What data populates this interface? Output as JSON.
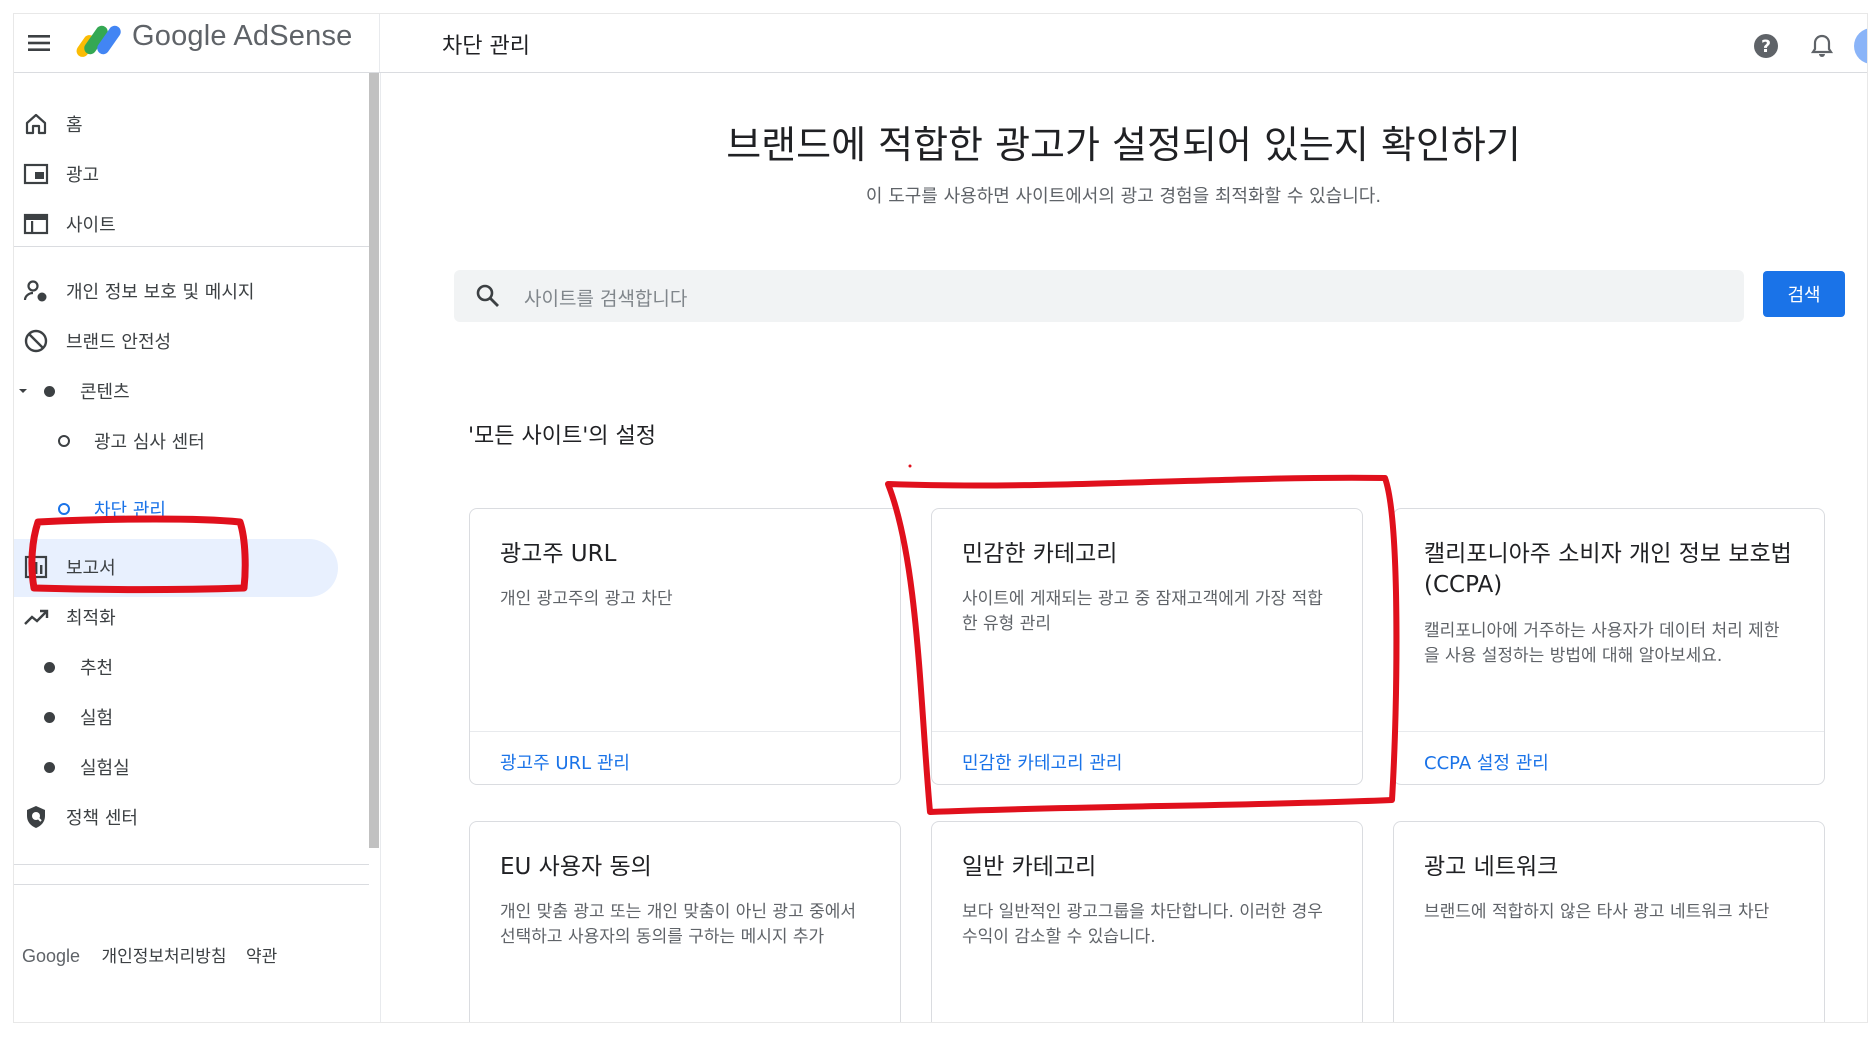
{
  "header": {
    "logo_text": "Google AdSense",
    "page_title": "차단 관리"
  },
  "sidebar": {
    "items": [
      {
        "label": "홈",
        "icon": "home-icon"
      },
      {
        "label": "광고",
        "icon": "ads-icon"
      },
      {
        "label": "사이트",
        "icon": "sites-icon"
      },
      {
        "label": "개인 정보 보호 및 메시지",
        "icon": "privacy-messaging-icon"
      },
      {
        "label": "브랜드 안전성",
        "icon": "block-icon"
      },
      {
        "label": "콘텐츠",
        "icon": "dot-icon"
      },
      {
        "label": "광고 심사 센터",
        "icon": "ring-icon"
      },
      {
        "label": "차단 관리",
        "icon": "ring-icon",
        "active": true
      },
      {
        "label": "보고서",
        "icon": "reports-icon"
      },
      {
        "label": "최적화",
        "icon": "trending-up-icon"
      },
      {
        "label": "추천",
        "icon": "dot-icon"
      },
      {
        "label": "실험",
        "icon": "dot-icon"
      },
      {
        "label": "실험실",
        "icon": "dot-icon"
      },
      {
        "label": "정책 센터",
        "icon": "policy-shield-icon"
      }
    ],
    "footer": {
      "brand": "Google",
      "privacy": "개인정보처리방침",
      "terms": "약관"
    }
  },
  "main": {
    "title": "브랜드에 적합한 광고가 설정되어 있는지 확인하기",
    "subtitle": "이 도구를 사용하면 사이트에서의 광고 경험을 최적화할 수 있습니다.",
    "search": {
      "placeholder": "사이트를 검색합니다",
      "button": "검색"
    },
    "section_title": "'모든 사이트'의 설정",
    "cards": [
      {
        "title": "광고주 URL",
        "description": "개인 광고주의 광고 차단",
        "link": "광고주 URL 관리"
      },
      {
        "title": "민감한 카테고리",
        "description": "사이트에 게재되는 광고 중 잠재고객에게 가장 적합한 유형 관리",
        "link": "민감한 카테고리 관리"
      },
      {
        "title": "캘리포니아주 소비자 개인 정보 보호법(CCPA)",
        "description": "캘리포니아에 거주하는 사용자가 데이터 처리 제한을 사용 설정하는 방법에 대해 알아보세요.",
        "link": "CCPA 설정 관리"
      },
      {
        "title": "EU 사용자 동의",
        "description": "개인 맞춤 광고 또는 개인 맞춤이 아닌 광고 중에서 선택하고 사용자의 동의를 구하는 메시지 추가",
        "link": ""
      },
      {
        "title": "일반 카테고리",
        "description": "보다 일반적인 광고그룹을 차단합니다. 이러한 경우 수익이 감소할 수 있습니다.",
        "link": ""
      },
      {
        "title": "광고 네트워크",
        "description": "브랜드에 적합하지 않은 타사 광고 네트워크 차단",
        "link": ""
      }
    ]
  },
  "colors": {
    "accent": "#1a73e8",
    "active_bg": "#e8f0fe",
    "annotation_red": "#e0101c"
  }
}
